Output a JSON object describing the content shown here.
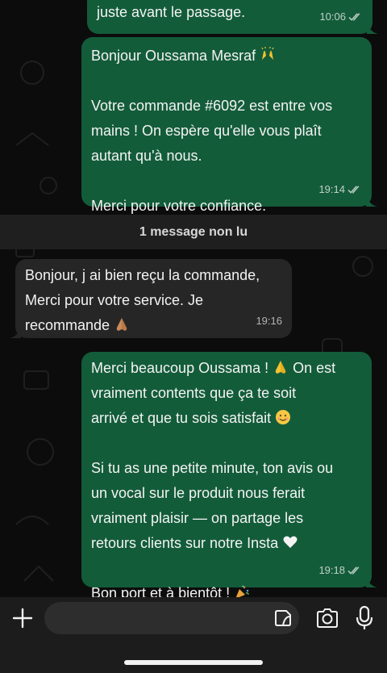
{
  "messages": [
    {
      "id": "m1",
      "direction": "outgoing",
      "lines": [
        "juste avant le passage."
      ],
      "time": "10:06",
      "status": "read"
    },
    {
      "id": "m2",
      "direction": "outgoing",
      "lines": [
        "Bonjour Oussama Mesraf",
        "",
        "Votre commande #6092 est entre vos",
        "mains ! On espère qu'elle vous plaît",
        "autant qu'à nous.",
        "",
        "Merci pour votre confiance."
      ],
      "emojis": [
        "raising-hands"
      ],
      "time": "19:14",
      "status": "read"
    },
    {
      "id": "m3",
      "direction": "incoming",
      "lines": [
        "Bonjour, j ai bien reçu la commande,",
        "Merci pour votre service. Je",
        "recommande"
      ],
      "emojis": [
        "folded-hands"
      ],
      "time": "19:16"
    },
    {
      "id": "m4",
      "direction": "outgoing",
      "lines": [
        "Merci beaucoup Oussama !",
        "On est",
        "vraiment contents que ça te soit",
        "arrivé et que tu sois satisfait",
        "",
        "Si tu as une petite minute, ton avis ou",
        "un vocal sur le produit nous ferait",
        "vraiment plaisir — on partage les",
        "retours clients sur notre Insta",
        "",
        "Bon port et à bientôt !"
      ],
      "emojis": [
        "folded-hands",
        "smiling-face",
        "white-heart",
        "party-popper"
      ],
      "time": "19:18",
      "status": "read"
    }
  ],
  "unread_banner": "1 message non lu",
  "composer": {
    "value": "",
    "placeholder": ""
  },
  "colors": {
    "outgoing_bubble": "#135c3a",
    "incoming_bubble": "#262626",
    "background": "#0c0c0c",
    "tick_read": "#9ecbb3"
  },
  "icons": [
    "plus-icon",
    "sticker-icon",
    "camera-icon",
    "microphone-icon",
    "double-check-icon"
  ]
}
